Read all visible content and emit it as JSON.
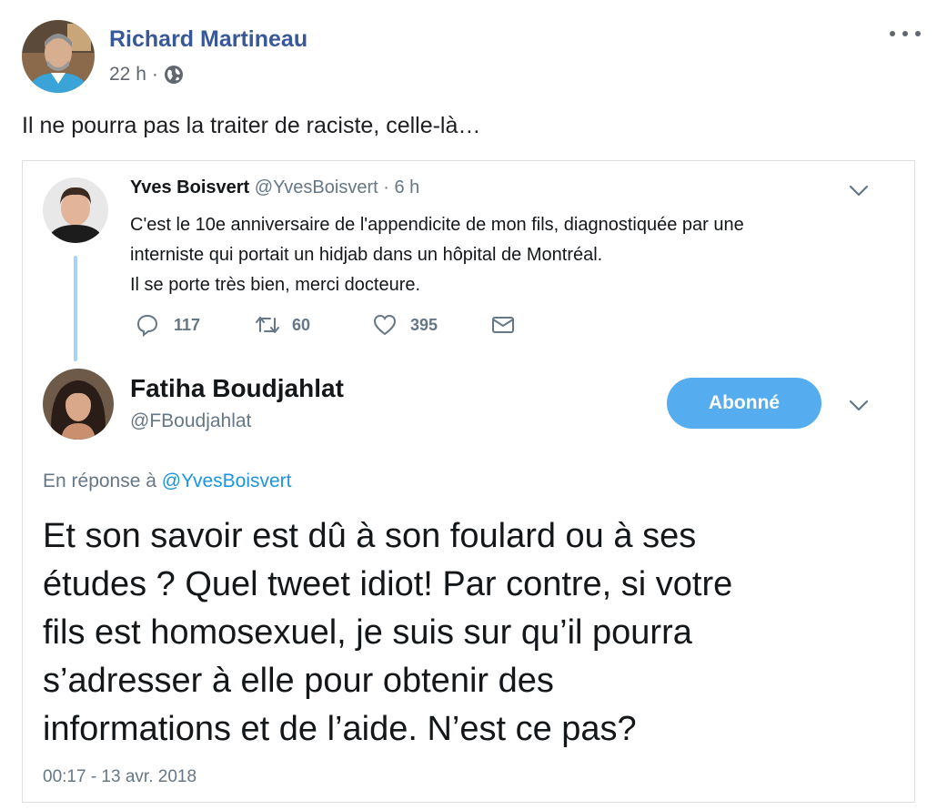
{
  "post": {
    "author_name": "Richard Martineau",
    "time": "22 h",
    "separator": "·",
    "text": "Il ne pourra pas la traiter de raciste, celle-là…",
    "privacy_icon": "globe-icon",
    "more_icon": "more-dots-icon"
  },
  "tweet_parent": {
    "name": "Yves Boisvert",
    "handle": "@YvesBoisvert",
    "time": "· 6 h",
    "lines": [
      "C'est le 10e anniversaire de l'appendicite de mon fils, diagnostiquée par une",
      "interniste qui portait un hidjab dans un hôpital de Montréal.",
      "Il se porte très bien, merci docteure."
    ],
    "actions": {
      "reply_count": "117",
      "retweet_count": "60",
      "like_count": "395"
    }
  },
  "tweet_main": {
    "name": "Fatiha Boudjahlat",
    "handle": "@FBoudjahlat",
    "follow_label": "Abonné",
    "reply_prefix": "En réponse à",
    "reply_mention": "@YvesBoisvert",
    "lines": [
      "Et son savoir est dû à son foulard ou à ses",
      "études ? Quel tweet idiot! Par contre, si votre",
      "fils est homosexuel, je suis sur qu’il pourra",
      "s’adresser à elle pour obtenir des",
      "informations et de l’aide. N’est ce pas?"
    ],
    "timestamp": "00:17 - 13 avr. 2018"
  },
  "colors": {
    "facebook_link": "#385898",
    "twitter_blue": "#55acee",
    "mention_blue": "#1b95e0",
    "thread_line": "#a8d3f5",
    "muted": "#657786"
  }
}
